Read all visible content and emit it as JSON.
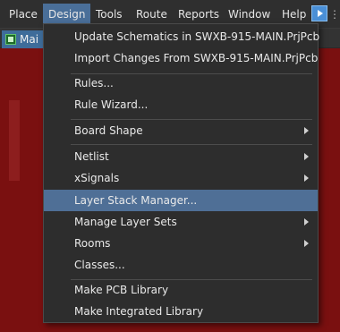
{
  "menubar": {
    "items": [
      {
        "label": "Place"
      },
      {
        "label": "Design"
      },
      {
        "label": "Tools"
      },
      {
        "label": "Route"
      },
      {
        "label": "Reports"
      },
      {
        "label": "Window"
      },
      {
        "label": "Help"
      }
    ]
  },
  "tab": {
    "label": "Mai"
  },
  "dropdown": {
    "items": [
      {
        "label": "Update Schematics in SWXB-915-MAIN.PrjPcb",
        "submenu": false
      },
      {
        "label": "Import Changes From SWXB-915-MAIN.PrjPcb",
        "submenu": false
      },
      {
        "label": "Rules...",
        "submenu": false
      },
      {
        "label": "Rule Wizard...",
        "submenu": false
      },
      {
        "label": "Board Shape",
        "submenu": true
      },
      {
        "label": "Netlist",
        "submenu": true
      },
      {
        "label": "xSignals",
        "submenu": true
      },
      {
        "label": "Layer Stack Manager...",
        "submenu": false,
        "highlighted": true
      },
      {
        "label": "Manage Layer Sets",
        "submenu": true
      },
      {
        "label": "Rooms",
        "submenu": true
      },
      {
        "label": "Classes...",
        "submenu": false
      },
      {
        "label": "Make PCB Library",
        "submenu": false
      },
      {
        "label": "Make Integrated Library",
        "submenu": false
      }
    ]
  },
  "colors": {
    "menu_highlight": "#4f6f96",
    "pcb_background": "#7a1010",
    "menu_background": "#2d2d2d"
  }
}
